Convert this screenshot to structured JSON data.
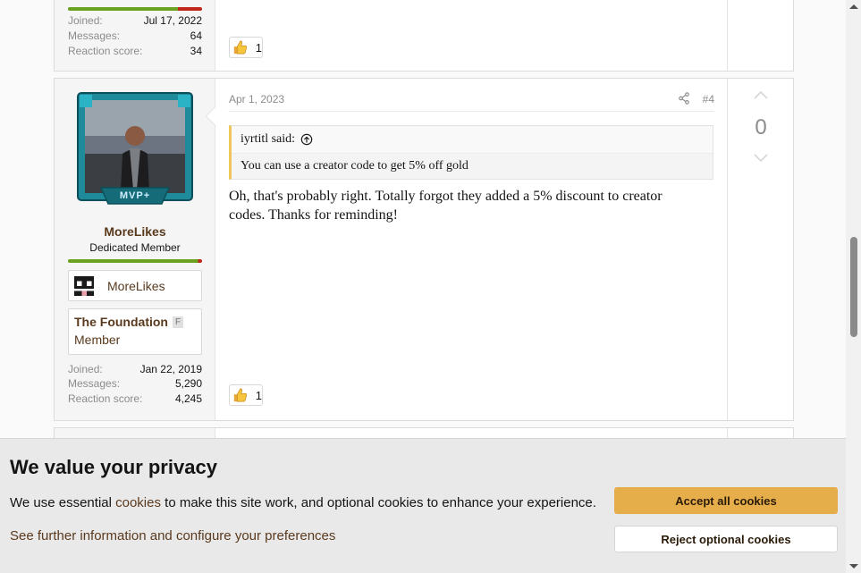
{
  "prev_post": {
    "stats": [
      {
        "label": "Joined:",
        "value": "Jul 17, 2022"
      },
      {
        "label": "Messages:",
        "value": "64"
      },
      {
        "label": "Reaction score:",
        "value": "34"
      }
    ],
    "reaction_count": "1"
  },
  "post": {
    "date": "Apr 1, 2023",
    "number": "#4",
    "user": {
      "name": "MoreLikes",
      "title": "Dedicated Member",
      "rank_badge": "MVP+",
      "minecraft_name": "MoreLikes",
      "guild_name": "The Foundation",
      "guild_tag": "F",
      "guild_rank": "Member",
      "stats": [
        {
          "label": "Joined:",
          "value": "Jan 22, 2019"
        },
        {
          "label": "Messages:",
          "value": "5,290"
        },
        {
          "label": "Reaction score:",
          "value": "4,245"
        }
      ]
    },
    "quote": {
      "author": "iyrtitl said:",
      "text": "You can use a creator code to get 5% off gold"
    },
    "body": "Oh, that's probably right. Totally forgot they added a 5% discount to creator codes. Thanks for reminding!",
    "reaction_count": "1",
    "vote_count": "0"
  },
  "cookie_banner": {
    "title": "We value your privacy",
    "message_before": "We use essential ",
    "message_link": "cookies",
    "message_after": " to make this site work, and optional cookies to enhance your experience.",
    "more_link": "See further information and configure your preferences",
    "accept_label": "Accept all cookies",
    "reject_label": "Reject optional cookies"
  },
  "colors": {
    "accent": "#e6ae4b",
    "link": "#5a3a1e",
    "level_bar": "#6aa121",
    "quote_border": "#f0c65b"
  },
  "icons": [
    "thumbs-up-icon",
    "share-icon",
    "arrow-up-circle-icon",
    "vote-up-icon",
    "vote-down-icon",
    "minecraft-head-icon"
  ]
}
